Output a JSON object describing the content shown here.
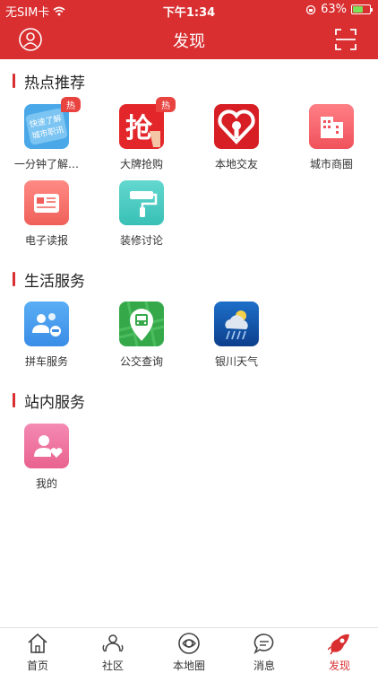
{
  "status_bar": {
    "carrier": "无SIM卡",
    "time": "下午1:34",
    "battery_percent": "63%",
    "battery_level": 0.63
  },
  "header": {
    "title": "发现"
  },
  "sections": [
    {
      "title": "热点推荐",
      "items": [
        {
          "label": "一分钟了解…",
          "badge": "热",
          "icon_text": "快速了解城市职讯"
        },
        {
          "label": "大牌抢购",
          "badge": "热",
          "icon_text": "抢"
        },
        {
          "label": "本地交友",
          "badge": ""
        },
        {
          "label": "城市商圈",
          "badge": ""
        },
        {
          "label": "电子读报",
          "badge": ""
        },
        {
          "label": "装修讨论",
          "badge": ""
        }
      ]
    },
    {
      "title": "生活服务",
      "items": [
        {
          "label": "拼车服务"
        },
        {
          "label": "公交查询"
        },
        {
          "label": "银川天气"
        }
      ]
    },
    {
      "title": "站内服务",
      "items": [
        {
          "label": "我的"
        }
      ]
    }
  ],
  "tabbar": [
    {
      "label": "首页",
      "icon": "home-icon"
    },
    {
      "label": "社区",
      "icon": "community-icon"
    },
    {
      "label": "本地圈",
      "icon": "local-circle-icon"
    },
    {
      "label": "消息",
      "icon": "message-icon"
    },
    {
      "label": "发现",
      "icon": "discover-icon",
      "active": true
    }
  ],
  "colors": {
    "primary": "#d92f31",
    "hot_badge": "#e8433f"
  }
}
